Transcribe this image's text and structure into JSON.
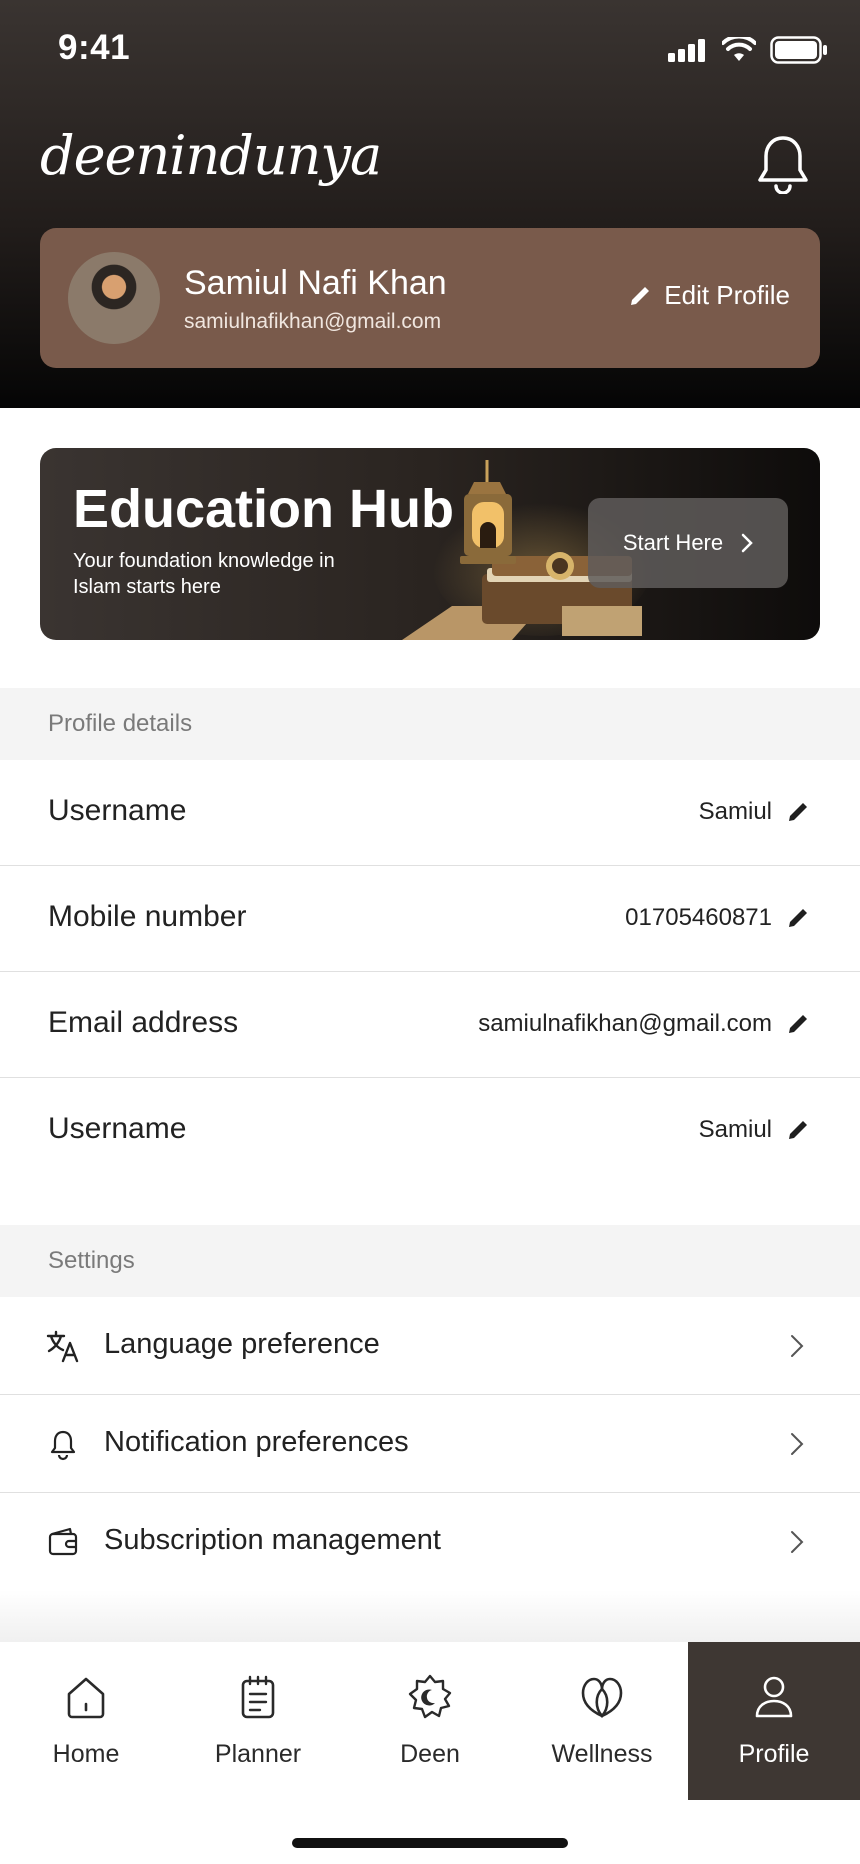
{
  "status": {
    "time": "9:41"
  },
  "header": {
    "logo": "deenindunya"
  },
  "profile": {
    "name": "Samiul Nafi Khan",
    "email": "samiulnafikhan@gmail.com",
    "edit_label": "Edit Profile"
  },
  "edu": {
    "title": "Education Hub",
    "subtitle": "Your foundation knowledge in Islam starts here",
    "button": "Start Here"
  },
  "profile_details": {
    "heading": "Profile details",
    "rows": [
      {
        "label": "Username",
        "value": "Samiul"
      },
      {
        "label": "Mobile number",
        "value": "01705460871"
      },
      {
        "label": "Email address",
        "value": "samiulnafikhan@gmail.com"
      },
      {
        "label": "Username",
        "value": "Samiul"
      }
    ]
  },
  "settings": {
    "heading": "Settings",
    "items": [
      {
        "label": "Language preference",
        "icon": "translate-icon"
      },
      {
        "label": "Notification preferences",
        "icon": "bell-icon"
      },
      {
        "label": "Subscription management",
        "icon": "wallet-icon"
      }
    ]
  },
  "nav": {
    "items": [
      {
        "label": "Home",
        "icon": "home-icon"
      },
      {
        "label": "Planner",
        "icon": "planner-icon"
      },
      {
        "label": "Deen",
        "icon": "deen-icon"
      },
      {
        "label": "Wellness",
        "icon": "wellness-icon"
      },
      {
        "label": "Profile",
        "icon": "profile-icon",
        "active": true
      }
    ]
  },
  "colors": {
    "profile_card": "#795a4b",
    "nav_active": "#3e3733",
    "header_dark": "#221d1b"
  }
}
